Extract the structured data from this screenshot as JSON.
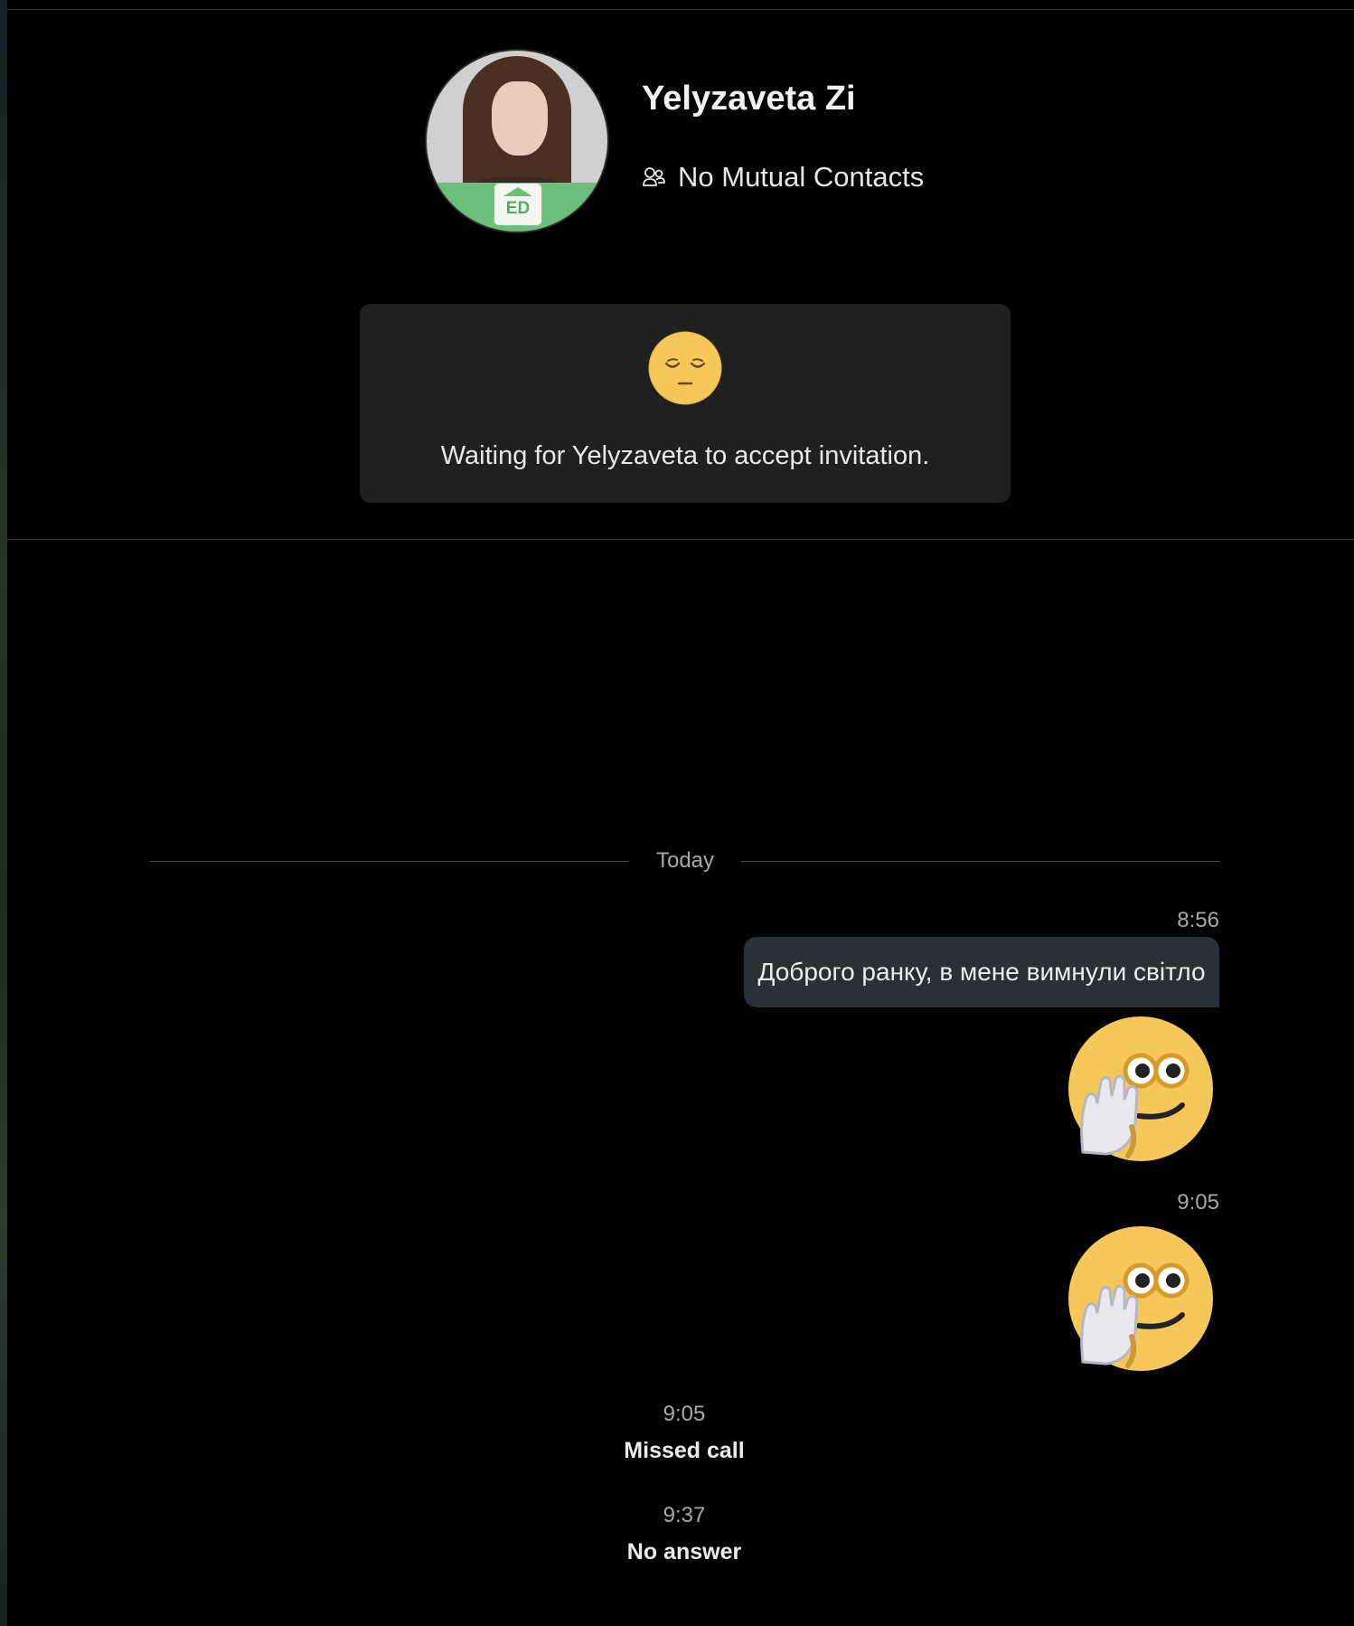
{
  "contact": {
    "name": "Yelyzaveta Zi",
    "mutual_contacts": "No Mutual Contacts",
    "avatar_badge": "ED"
  },
  "invitation": {
    "emoji_icon": "relieved-face-emoji",
    "text": "Waiting for Yelyzaveta to accept invitation."
  },
  "conversation": {
    "date_divider": "Today",
    "messages": [
      {
        "time": "8:56",
        "text": "Доброго ранку, в мене вимнули світло"
      },
      {
        "sticker": "hand-over-mouth-emoji"
      },
      {
        "time": "9:05",
        "sticker": "hand-over-mouth-emoji"
      }
    ],
    "calls": [
      {
        "time": "9:05",
        "status": "Missed call"
      },
      {
        "time": "9:37",
        "status": "No answer"
      }
    ]
  },
  "colors": {
    "background": "#000000",
    "card": "#202020",
    "bubble": "#2b3036",
    "badge_green": "#6bbf7a",
    "emoji_yellow": "#f6c85a"
  }
}
